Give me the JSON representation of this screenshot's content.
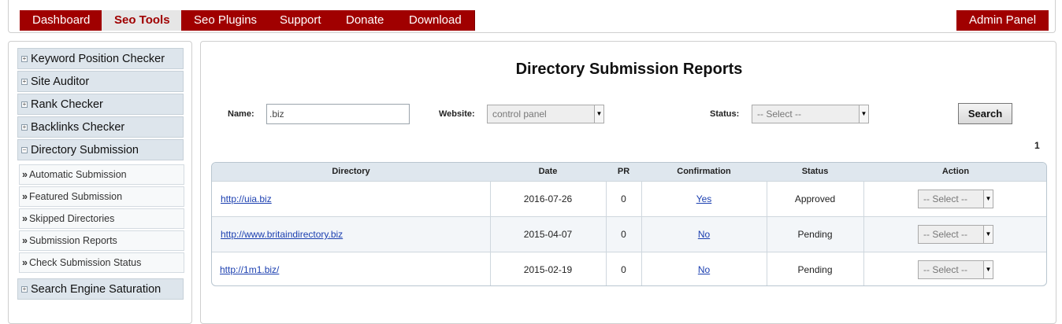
{
  "nav": {
    "tabs": [
      {
        "label": "Dashboard"
      },
      {
        "label": "Seo Tools",
        "active": true
      },
      {
        "label": "Seo Plugins"
      },
      {
        "label": "Support"
      },
      {
        "label": "Donate"
      },
      {
        "label": "Download"
      }
    ],
    "admin_label": "Admin Panel"
  },
  "sidebar": {
    "menus": [
      {
        "label": "Keyword Position Checker",
        "expanded": false
      },
      {
        "label": "Site Auditor",
        "expanded": false
      },
      {
        "label": "Rank Checker",
        "expanded": false
      },
      {
        "label": "Backlinks Checker",
        "expanded": false
      },
      {
        "label": "Directory Submission",
        "expanded": true
      },
      {
        "label": "Search Engine Saturation",
        "expanded": false
      }
    ],
    "submenu": [
      {
        "label": "Automatic Submission"
      },
      {
        "label": "Featured Submission"
      },
      {
        "label": "Skipped Directories"
      },
      {
        "label": "Submission Reports"
      },
      {
        "label": "Check Submission Status"
      }
    ],
    "expand_icon": "+",
    "collapse_icon": "−",
    "bullet": "»"
  },
  "main": {
    "title": "Directory Submission Reports",
    "filters": {
      "name_label": "Name:",
      "name_value": ".biz",
      "website_label": "Website:",
      "website_value": "control panel",
      "status_label": "Status:",
      "status_value": "-- Select --",
      "search_label": "Search"
    },
    "page_number": "1",
    "table": {
      "headers": [
        "Directory",
        "Date",
        "PR",
        "Confirmation",
        "Status",
        "Action"
      ],
      "rows": [
        {
          "directory": "http://uia.biz",
          "date": "2016-07-26",
          "pr": "0",
          "confirmation": "Yes",
          "status": "Approved",
          "action": "-- Select --"
        },
        {
          "directory": "http://www.britaindirectory.biz",
          "date": "2015-04-07",
          "pr": "0",
          "confirmation": "No",
          "status": "Pending",
          "action": "-- Select --"
        },
        {
          "directory": "http://1m1.biz/",
          "date": "2015-02-19",
          "pr": "0",
          "confirmation": "No",
          "status": "Pending",
          "action": "-- Select --"
        }
      ]
    }
  },
  "colors": {
    "brand": "#a00000",
    "link": "#1b3fb0",
    "table_header": "#dfe7ee"
  }
}
